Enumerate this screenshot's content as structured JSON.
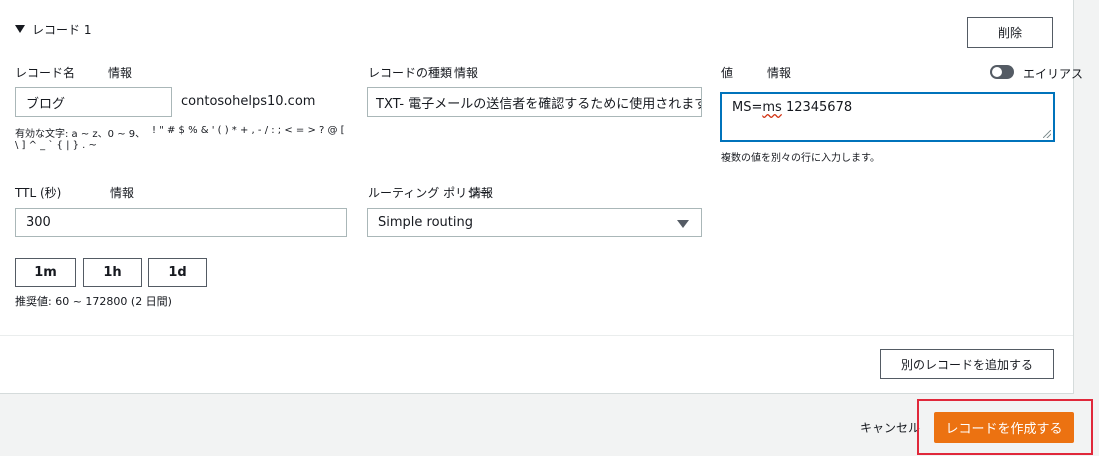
{
  "record": {
    "section_title": "レコード 1",
    "delete_label": "削除",
    "name": {
      "label": "レコード名",
      "info": "情報",
      "value": "ブログ",
      "domain_suffix": "contosohelps10.com",
      "hint_line1": "有効な文字: a ~ z、0 ~ 9、",
      "hint_chars": "! \" # $ % & ' ( ) * + , - / : ; < = > ? @ [",
      "hint_line2": "\\ ] ^ _ ` { | } . ~"
    },
    "type": {
      "label": "レコードの種類",
      "info": "情報",
      "value": "TXT- 電子メールの送信者を確認するために使用されます。"
    },
    "value": {
      "label": "値",
      "info": "情報",
      "alias_label": "エイリアス",
      "text_prefix": "MS=",
      "text_misspelled": "ms",
      "text_rest": " 12345678",
      "hint": "複数の値を別々の行に入力します。"
    },
    "ttl": {
      "label": "TTL (秒)",
      "info": "情報",
      "value": "300",
      "buttons": [
        "1m",
        "1h",
        "1d"
      ],
      "recommended": "推奨値: 60 ~ 172800 (2 日間)"
    },
    "routing": {
      "label": "ルーティング ポリシー",
      "info": "情報",
      "value": "Simple routing"
    },
    "add_another_label": "別のレコードを追加する"
  },
  "footer": {
    "cancel_label": "キャンセル",
    "create_label": "レコードを作成する"
  },
  "colors": {
    "primary": "#ec7211",
    "focus": "#0073bb",
    "highlight": "#e0283a"
  }
}
